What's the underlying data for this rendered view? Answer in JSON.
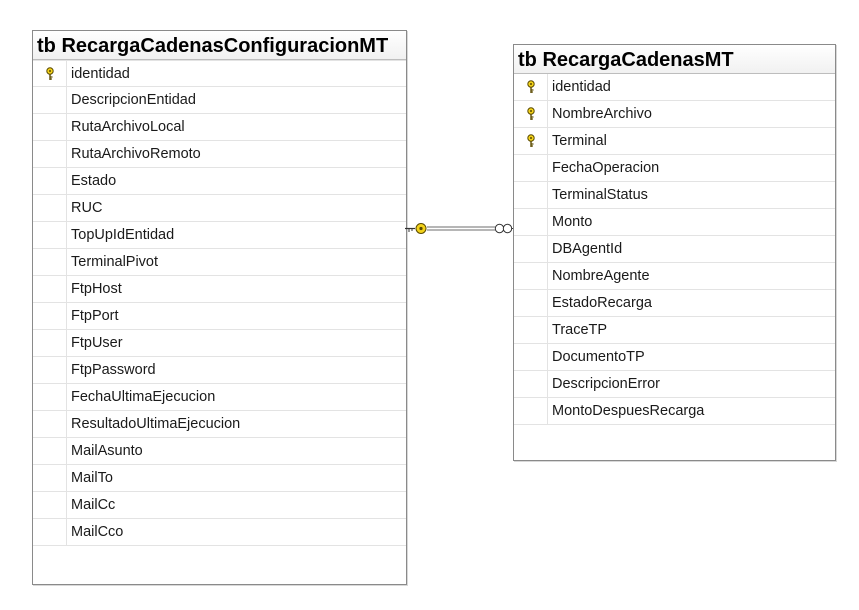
{
  "tables": [
    {
      "prefix": "tb",
      "name": "RecargaCadenasConfiguracionMT",
      "columns": [
        {
          "name": "identidad",
          "key": true
        },
        {
          "name": "DescripcionEntidad",
          "key": false
        },
        {
          "name": "RutaArchivoLocal",
          "key": false
        },
        {
          "name": "RutaArchivoRemoto",
          "key": false
        },
        {
          "name": "Estado",
          "key": false
        },
        {
          "name": "RUC",
          "key": false
        },
        {
          "name": "TopUpIdEntidad",
          "key": false
        },
        {
          "name": "TerminalPivot",
          "key": false
        },
        {
          "name": "FtpHost",
          "key": false
        },
        {
          "name": "FtpPort",
          "key": false
        },
        {
          "name": "FtpUser",
          "key": false
        },
        {
          "name": "FtpPassword",
          "key": false
        },
        {
          "name": "FechaUltimaEjecucion",
          "key": false
        },
        {
          "name": "ResultadoUltimaEjecucion",
          "key": false
        },
        {
          "name": "MailAsunto",
          "key": false
        },
        {
          "name": "MailTo",
          "key": false
        },
        {
          "name": "MailCc",
          "key": false
        },
        {
          "name": "MailCco",
          "key": false
        }
      ]
    },
    {
      "prefix": "tb",
      "name": "RecargaCadenasMT",
      "columns": [
        {
          "name": "identidad",
          "key": true
        },
        {
          "name": "NombreArchivo",
          "key": true
        },
        {
          "name": "Terminal",
          "key": true
        },
        {
          "name": "FechaOperacion",
          "key": false
        },
        {
          "name": "TerminalStatus",
          "key": false
        },
        {
          "name": "Monto",
          "key": false
        },
        {
          "name": "DBAgentId",
          "key": false
        },
        {
          "name": "NombreAgente",
          "key": false
        },
        {
          "name": "EstadoRecarga",
          "key": false
        },
        {
          "name": "TraceTP",
          "key": false
        },
        {
          "name": "DocumentoTP",
          "key": false
        },
        {
          "name": "DescripcionError",
          "key": false
        },
        {
          "name": "MontoDespuesRecarga",
          "key": false
        }
      ]
    }
  ],
  "relationship": {
    "from_end": "one-key-icon",
    "to_end": "many-infinity-icon",
    "line_color": "#6e6e6e",
    "key_color": "#e8c800"
  }
}
